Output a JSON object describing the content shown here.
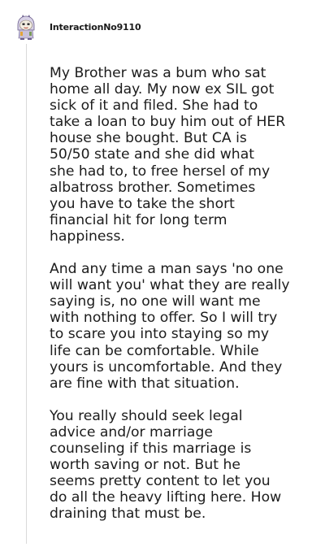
{
  "comment": {
    "username": "InteractionNo9110",
    "avatar_icon": "snoo-avatar-icon",
    "paragraphs": [
      "My Brother was a bum who sat\nhome all day. My now ex SIL got\nsick of it and filed. She had to\ntake a loan to buy him out of HER\nhouse she bought. But CA is\n50/50 state and she did what\nshe had to, to free hersel of my\nalbatross brother. Sometimes\nyou have to take the short\nfinancial hit for long term\nhappiness.",
      "And any time a man says 'no one\nwill want you' what they are really\nsaying is, no one will want me\nwith nothing to offer. So I will try\nto scare you into staying so my\nlife can be comfortable. While\nyours is uncomfortable. And they\nare fine with that situation.",
      "You really should seek legal\nadvice and/or marriage\ncounseling if this marriage is\nworth saving or not. But he\nseems pretty content to let you\ndo all the heavy lifting here. How\ndraining that must be."
    ]
  }
}
